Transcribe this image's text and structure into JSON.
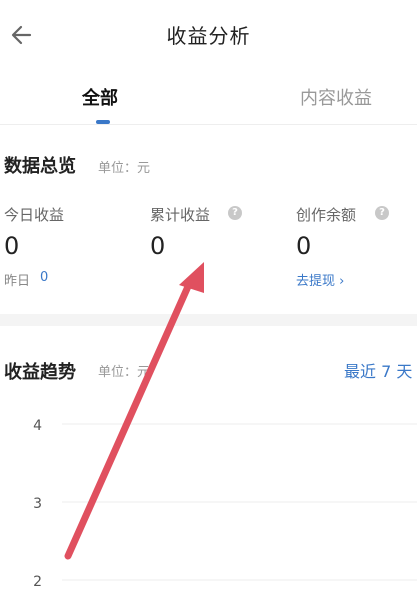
{
  "header": {
    "title": "收益分析",
    "back_icon": "arrow-left-icon"
  },
  "tabs": [
    {
      "label": "全部",
      "active": true
    },
    {
      "label": "内容收益",
      "active": false
    }
  ],
  "overview": {
    "title": "数据总览",
    "unit": "单位：元",
    "stats": [
      {
        "label": "今日收益",
        "value": "0",
        "has_help": false
      },
      {
        "label": "累计收益",
        "value": "0",
        "has_help": true
      },
      {
        "label": "创作余额",
        "value": "0",
        "has_help": true
      }
    ],
    "yesterday_label": "昨日",
    "yesterday_value": "0",
    "withdraw_label": "去提现 ›"
  },
  "trend": {
    "title": "收益趋势",
    "unit": "单位：元",
    "range_label": "最近 7 天"
  },
  "chart_data": {
    "type": "line",
    "title": "",
    "xlabel": "",
    "ylabel": "",
    "y_ticks": [
      2,
      3,
      4
    ],
    "ylim": [
      2,
      4
    ],
    "series": [],
    "grid": true
  },
  "colors": {
    "accent": "#3a78c8",
    "annotation_arrow": "#e0505f"
  }
}
